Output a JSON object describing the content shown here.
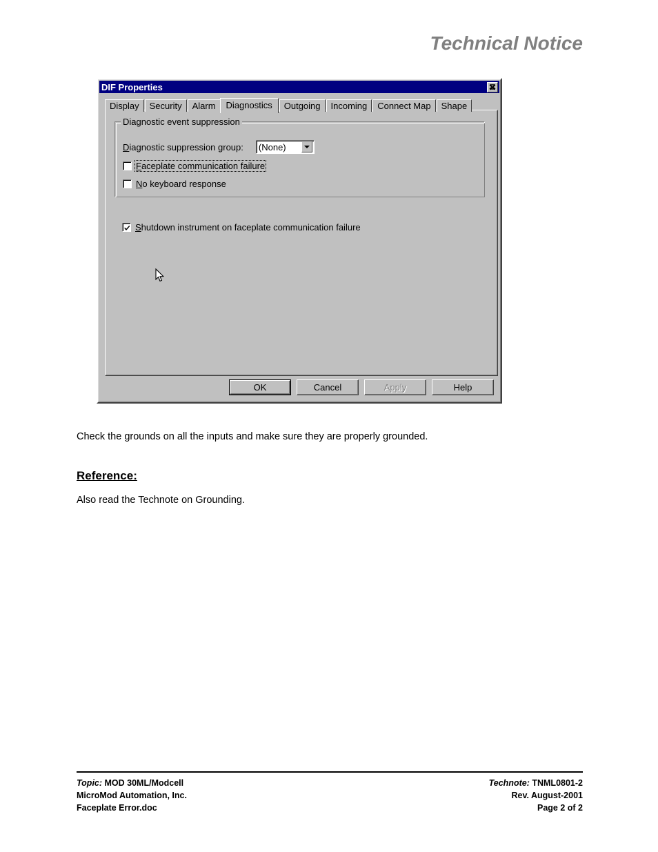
{
  "page": {
    "header_title": "Technical Notice"
  },
  "dialog": {
    "title": "DIF Properties",
    "close_icon": "close-icon",
    "tabs": [
      {
        "label": "Display",
        "selected": false
      },
      {
        "label": "Security",
        "selected": false
      },
      {
        "label": "Alarm",
        "selected": false
      },
      {
        "label": "Diagnostics",
        "selected": true
      },
      {
        "label": "Outgoing",
        "selected": false
      },
      {
        "label": "Incoming",
        "selected": false
      },
      {
        "label": "Connect Map",
        "selected": false
      },
      {
        "label": "Shape",
        "selected": false
      }
    ],
    "group": {
      "legend": "Diagnostic event suppression",
      "combo": {
        "label_accel": "D",
        "label_rest": "iagnostic suppression group:",
        "value": "(None)",
        "arrow_icon": "chevron-down-icon"
      },
      "checkboxes": [
        {
          "accel": "F",
          "rest": "aceplate communication failure",
          "checked": false,
          "focused": true
        },
        {
          "accel": "N",
          "rest": "o keyboard response",
          "checked": false,
          "focused": false
        }
      ]
    },
    "shutdown_checkbox": {
      "accel": "S",
      "rest": "hutdown instrument on faceplate communication failure",
      "checked": true
    },
    "buttons": [
      {
        "label": "OK",
        "default": true,
        "disabled": false
      },
      {
        "label": "Cancel",
        "default": false,
        "disabled": false
      },
      {
        "label": "Apply",
        "default": false,
        "disabled": true
      },
      {
        "label": "Help",
        "default": false,
        "disabled": false
      }
    ],
    "cursor_icon": "mouse-pointer-icon"
  },
  "content": {
    "paragraph_grounds": "Check the grounds on all the inputs and make sure they are properly grounded.",
    "reference_heading": "Reference:",
    "paragraph_reference": "Also read the Technote on Grounding."
  },
  "footer": {
    "left": {
      "topic_label": "Topic:",
      "topic_value": "MOD 30ML/Modcell",
      "company": "MicroMod Automation, Inc.",
      "filename": "Faceplate Error.doc"
    },
    "right": {
      "technote_label": "Technote:",
      "technote_value": "TNML0801-2",
      "revision": "Rev. August-2001",
      "page": "Page  2 of 2"
    }
  },
  "colors": {
    "titlebar": "#000080",
    "face": "#c0c0c0",
    "header_gray": "#808080"
  }
}
